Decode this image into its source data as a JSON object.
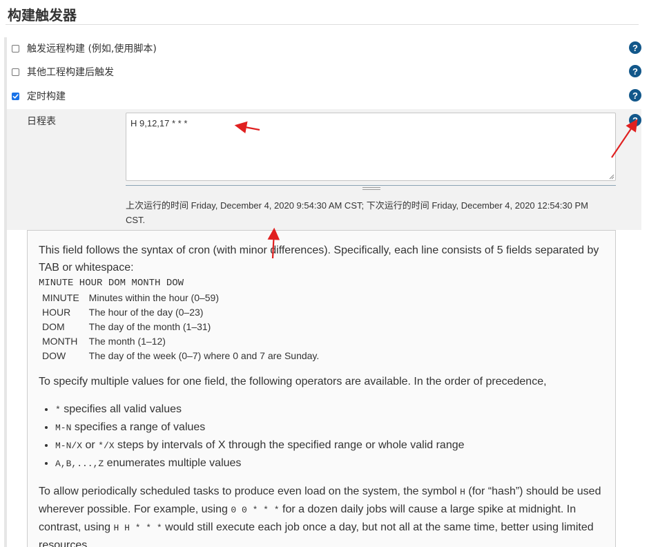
{
  "section": {
    "title": "构建触发器"
  },
  "options": [
    {
      "label": "触发远程构建 (例如,使用脚本)",
      "checked": false
    },
    {
      "label": "其他工程构建后触发",
      "checked": false
    },
    {
      "label": "定时构建",
      "checked": true
    }
  ],
  "schedule": {
    "label": "日程表",
    "value": "H 9,12,17 * * *",
    "run_info": "上次运行的时间 Friday, December 4, 2020 9:54:30 AM CST; 下次运行的时间 Friday, December 4, 2020 12:54:30 PM CST."
  },
  "help": {
    "intro": "This field follows the syntax of cron (with minor differences). Specifically, each line consists of 5 fields separated by TAB or whitespace:",
    "fields_header": "MINUTE HOUR DOM MONTH DOW",
    "fields": [
      {
        "name": "MINUTE",
        "desc": "Minutes within the hour (0–59)"
      },
      {
        "name": "HOUR",
        "desc": "The hour of the day (0–23)"
      },
      {
        "name": "DOM",
        "desc": "The day of the month (1–31)"
      },
      {
        "name": "MONTH",
        "desc": "The month (1–12)"
      },
      {
        "name": "DOW",
        "desc": "The day of the week (0–7) where 0 and 7 are Sunday."
      }
    ],
    "operators_intro": "To specify multiple values for one field, the following operators are available. In the order of precedence,",
    "operators": [
      {
        "code": "*",
        "text": " specifies all valid values"
      },
      {
        "code": "M-N",
        "text": " specifies a range of values"
      },
      {
        "code": "M-N/X",
        "mid": " or ",
        "code2": "*/X",
        "text": " steps by intervals of X through the specified range or whole valid range"
      },
      {
        "code": "A,B,...,Z",
        "text": " enumerates multiple values"
      }
    ],
    "hash": {
      "t1": "To allow periodically scheduled tasks to produce even load on the system, the symbol ",
      "c1": "H",
      "t2": " (for “hash”) should be used wherever possible. For example, using ",
      "c2": "0 0 * * *",
      "t3": " for a dozen daily jobs will cause a large spike at midnight. In contrast, using ",
      "c3": "H H * * *",
      "t4": " would still execute each job once a day, but not all at the same time, better using limited resources."
    }
  },
  "help_icon_glyph": "?",
  "colors": {
    "help_icon": "#12578a",
    "annotation_arrow": "#e02020",
    "checkbox_checked": "#1a73e8"
  }
}
